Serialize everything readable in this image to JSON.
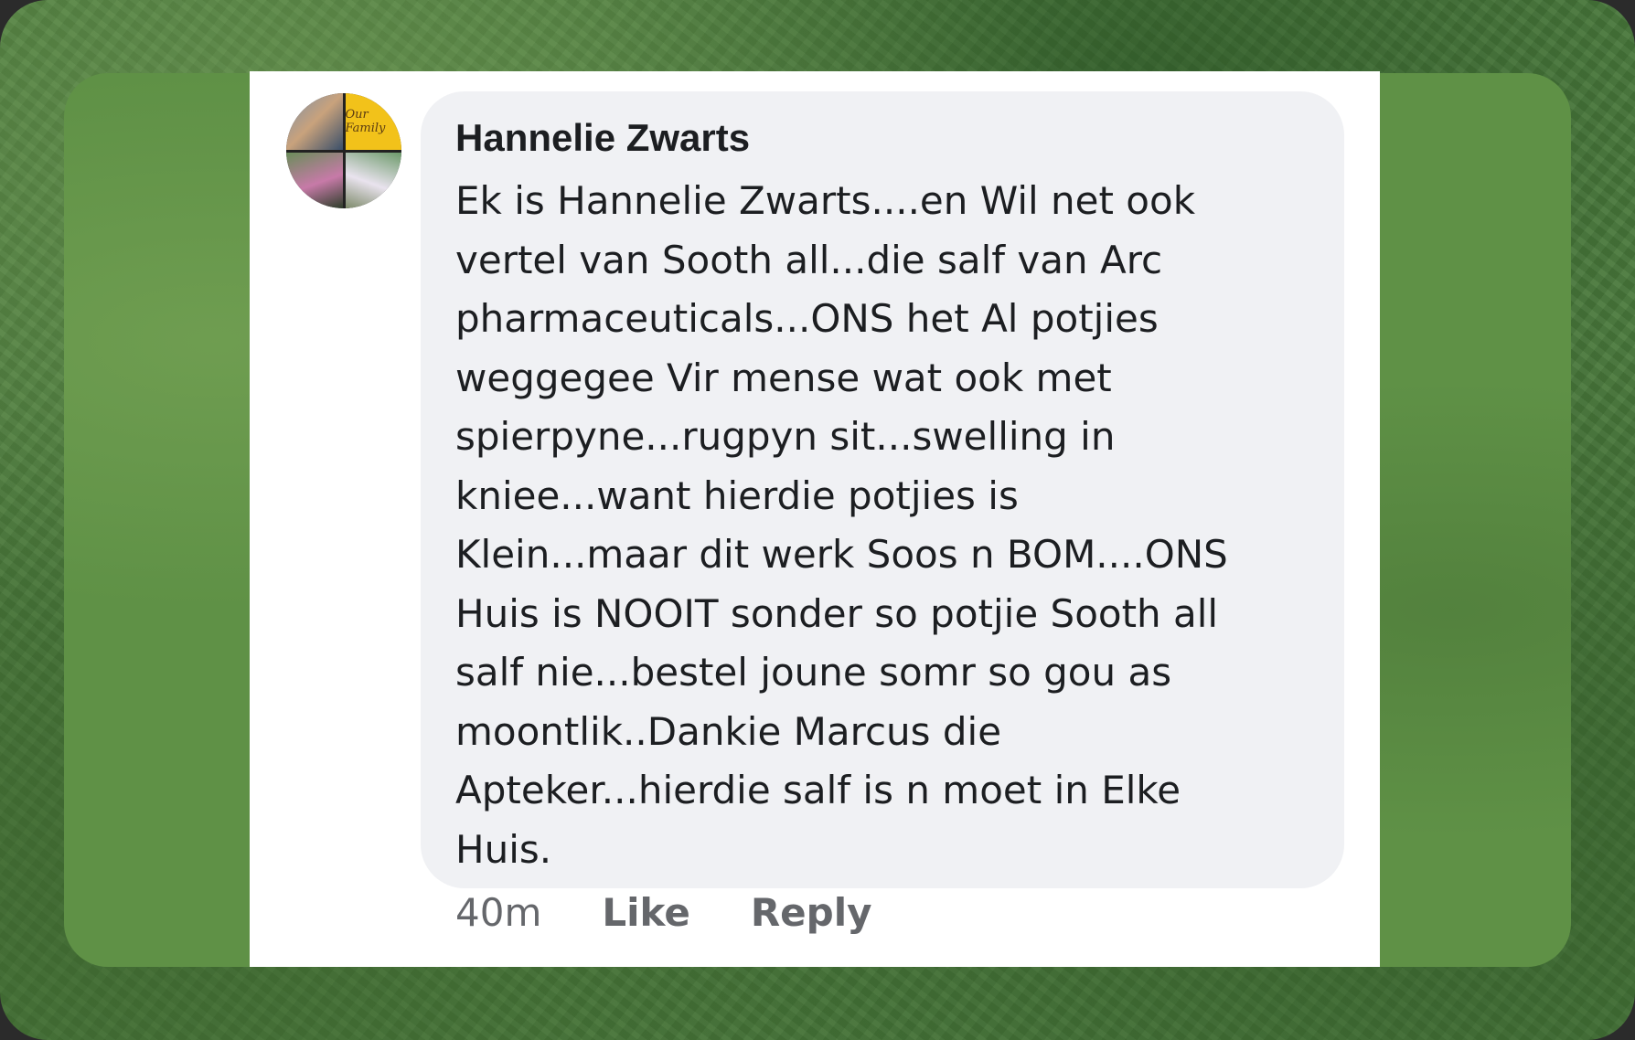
{
  "comment": {
    "author": "Hannelie Zwarts",
    "text": "Ek is Hannelie Zwarts....en Wil net ook\nvertel van Sooth all...die salf van Arc\npharmaceuticals...ONS het Al potjies\nweggegee Vir mense wat ook met\nspierpyne...rugpyn sit...swelling in\nkniee...want hierdie potjies is\nKlein...maar dit werk Soos n BOM....ONS\nHuis is NOOIT sonder so potjie Sooth all\nsalf nie...bestel joune somr so gou as\nmoontlik..Dankie Marcus die\nApteker...hierdie salf is n moet in Elke\nHuis.",
    "timestamp": "40m",
    "like_label": "Like",
    "reply_label": "Reply"
  },
  "avatar": {
    "icon": "profile-photo-collage-icon",
    "badge_text": "Our Family"
  },
  "colors": {
    "background_green": "#4a7a3c",
    "bubble": "#f0f1f4",
    "text": "#1c1e21",
    "meta": "#65676b"
  }
}
